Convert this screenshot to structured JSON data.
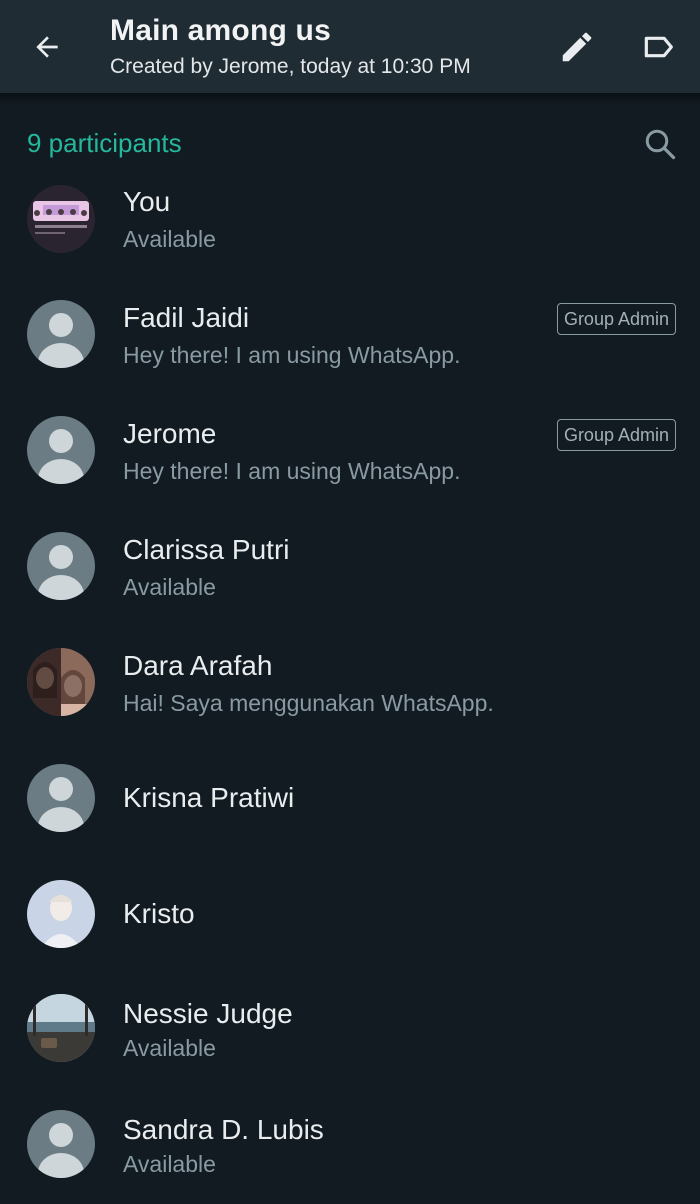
{
  "header": {
    "title": "Main among us",
    "subtitle": "Created by Jerome, today at 10:30 PM",
    "back_icon": "arrow-left-icon",
    "edit_icon": "pencil-icon",
    "label_icon": "label-tag-icon"
  },
  "participants": {
    "count_label": "9 participants",
    "search_icon": "search-icon",
    "admin_badge_label": "Group Admin",
    "list": [
      {
        "name": "You",
        "status": "Available",
        "admin": false,
        "avatar": "photo-group"
      },
      {
        "name": "Fadil Jaidi",
        "status": "Hey there! I am using WhatsApp.",
        "admin": true,
        "avatar": "default"
      },
      {
        "name": "Jerome",
        "status": "Hey there! I am using WhatsApp.",
        "admin": true,
        "avatar": "default"
      },
      {
        "name": "Clarissa Putri",
        "status": "Available",
        "admin": false,
        "avatar": "default"
      },
      {
        "name": "Dara Arafah",
        "status": "Hai! Saya menggunakan WhatsApp.",
        "admin": false,
        "avatar": "photo-woman"
      },
      {
        "name": "Krisna Pratiwi",
        "status": "",
        "admin": false,
        "avatar": "default"
      },
      {
        "name": "Kristo",
        "status": "",
        "admin": false,
        "avatar": "photo-man"
      },
      {
        "name": "Nessie Judge",
        "status": "Available",
        "admin": false,
        "avatar": "photo-landscape"
      },
      {
        "name": "Sandra D. Lubis",
        "status": "Available",
        "admin": false,
        "avatar": "default"
      }
    ]
  },
  "colors": {
    "background": "#111b21",
    "appbar": "#1f2c33",
    "accent": "#25b89c",
    "secondary_text": "#8a9aa3"
  }
}
